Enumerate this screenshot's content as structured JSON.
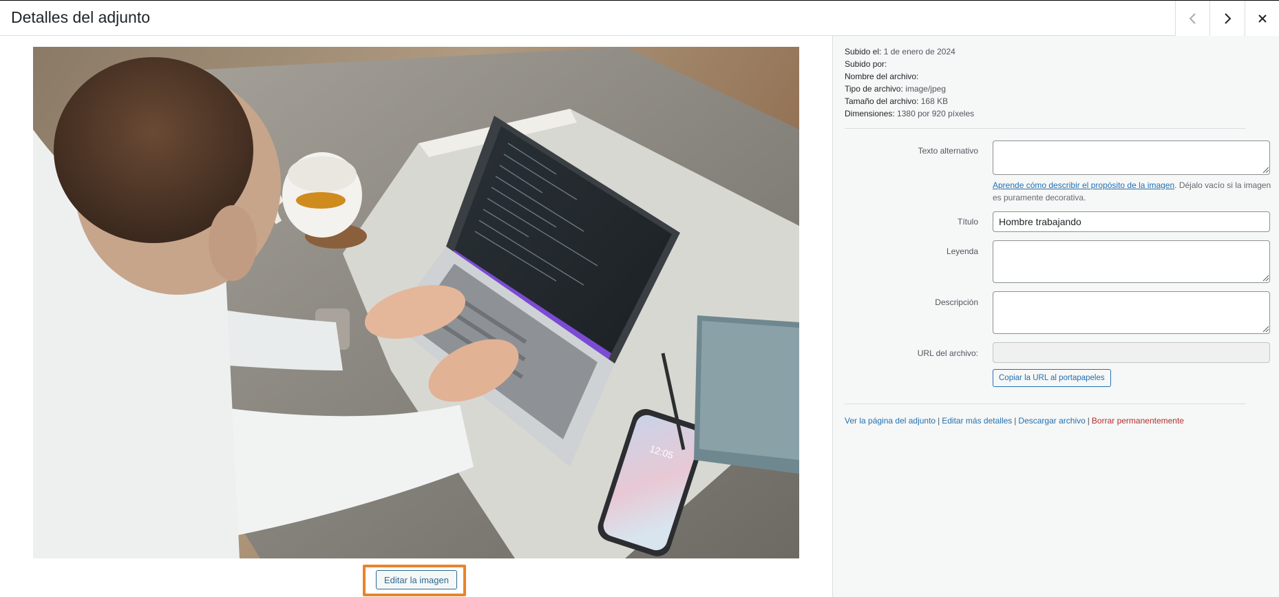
{
  "header": {
    "title": "Detalles del adjunto",
    "prev_icon": "chevron-left-icon",
    "next_icon": "chevron-right-icon",
    "close_icon": "close-icon"
  },
  "preview": {
    "edit_button_label": "Editar la imagen",
    "image_subject": "man-typing-on-laptop-photo",
    "phone_time": "12:05"
  },
  "details": {
    "uploaded_on_label": "Subido el:",
    "uploaded_on_value": "1 de enero de 2024",
    "uploaded_by_label": "Subido por:",
    "uploaded_by_value": "",
    "file_name_label": "Nombre del archivo:",
    "file_name_value": "",
    "file_type_label": "Tipo de archivo:",
    "file_type_value": "image/jpeg",
    "file_size_label": "Tamaño del archivo:",
    "file_size_value": "168 KB",
    "dimensions_label": "Dimensiones:",
    "dimensions_value": "1380 por 920 píxeles"
  },
  "form": {
    "alt_text_label": "Texto alternativo",
    "alt_text_value": "",
    "alt_help_link": "Aprende cómo describir el propósito de la imagen",
    "alt_help_text": ". Déjalo vacío si la imagen es puramente decorativa.",
    "title_label": "Título",
    "title_value": "Hombre trabajando",
    "caption_label": "Leyenda",
    "caption_value": "",
    "description_label": "Descripción",
    "description_value": "",
    "file_url_label": "URL del archivo:",
    "file_url_value": "",
    "copy_url_button": "Copiar la URL al portapapeles"
  },
  "actions": {
    "view_page": "Ver la página del adjunto",
    "edit_more": "Editar más detalles",
    "download": "Descargar archivo",
    "delete": "Borrar permanentemente",
    "separator": "|"
  },
  "colors": {
    "link": "#2271b1",
    "danger": "#b32d2e",
    "highlight": "#e8842b",
    "sidebar_bg": "#f6f7f7"
  }
}
